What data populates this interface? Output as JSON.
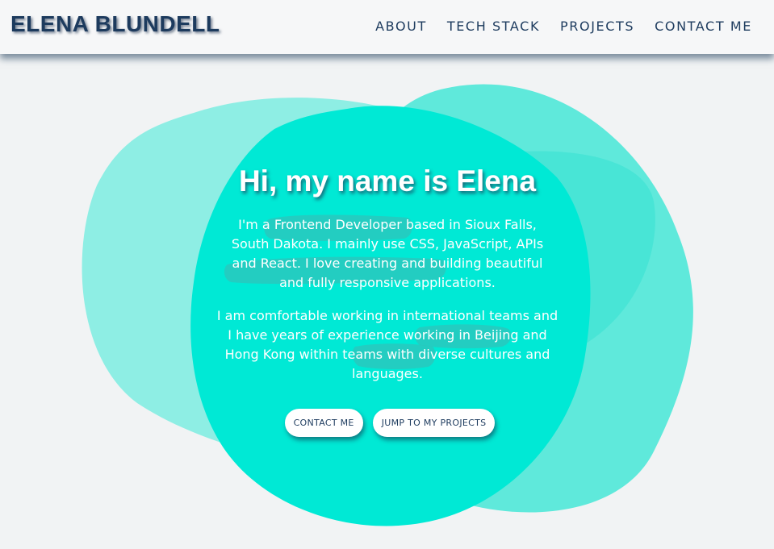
{
  "header": {
    "logo": "ELENA BLUNDELL",
    "nav": [
      "ABOUT",
      "TECH STACK",
      "PROJECTS",
      "CONTACT ME"
    ]
  },
  "hero": {
    "heading": "Hi, my name is Elena",
    "intro": {
      "t1": "I'm a ",
      "h1": "Frontend Developer",
      "t2": " based in Sioux Falls, South Dakota. I mainly use ",
      "h2": "CSS, JavaScript, APIs and React",
      "t3": ". I love creating and building beautiful and fully responsive applications."
    },
    "experience": {
      "t1": "I am comfortable working in ",
      "h1": "international",
      "t2": " teams and I have years of ",
      "h2": "experience",
      "t3": " working in Beijing and Hong Kong within teams with diverse cultures and languages."
    },
    "buttons": {
      "contact": "CONTACT ME",
      "projects": "JUMP TO MY PROJECTS"
    }
  },
  "colors": {
    "navy": "#1d3b5e",
    "teal_main": "#00e6d3",
    "teal_light": "#8eeee4",
    "teal_mid": "#58e8da",
    "highlight": "#2cc6bc",
    "background": "#f1f3f4"
  }
}
